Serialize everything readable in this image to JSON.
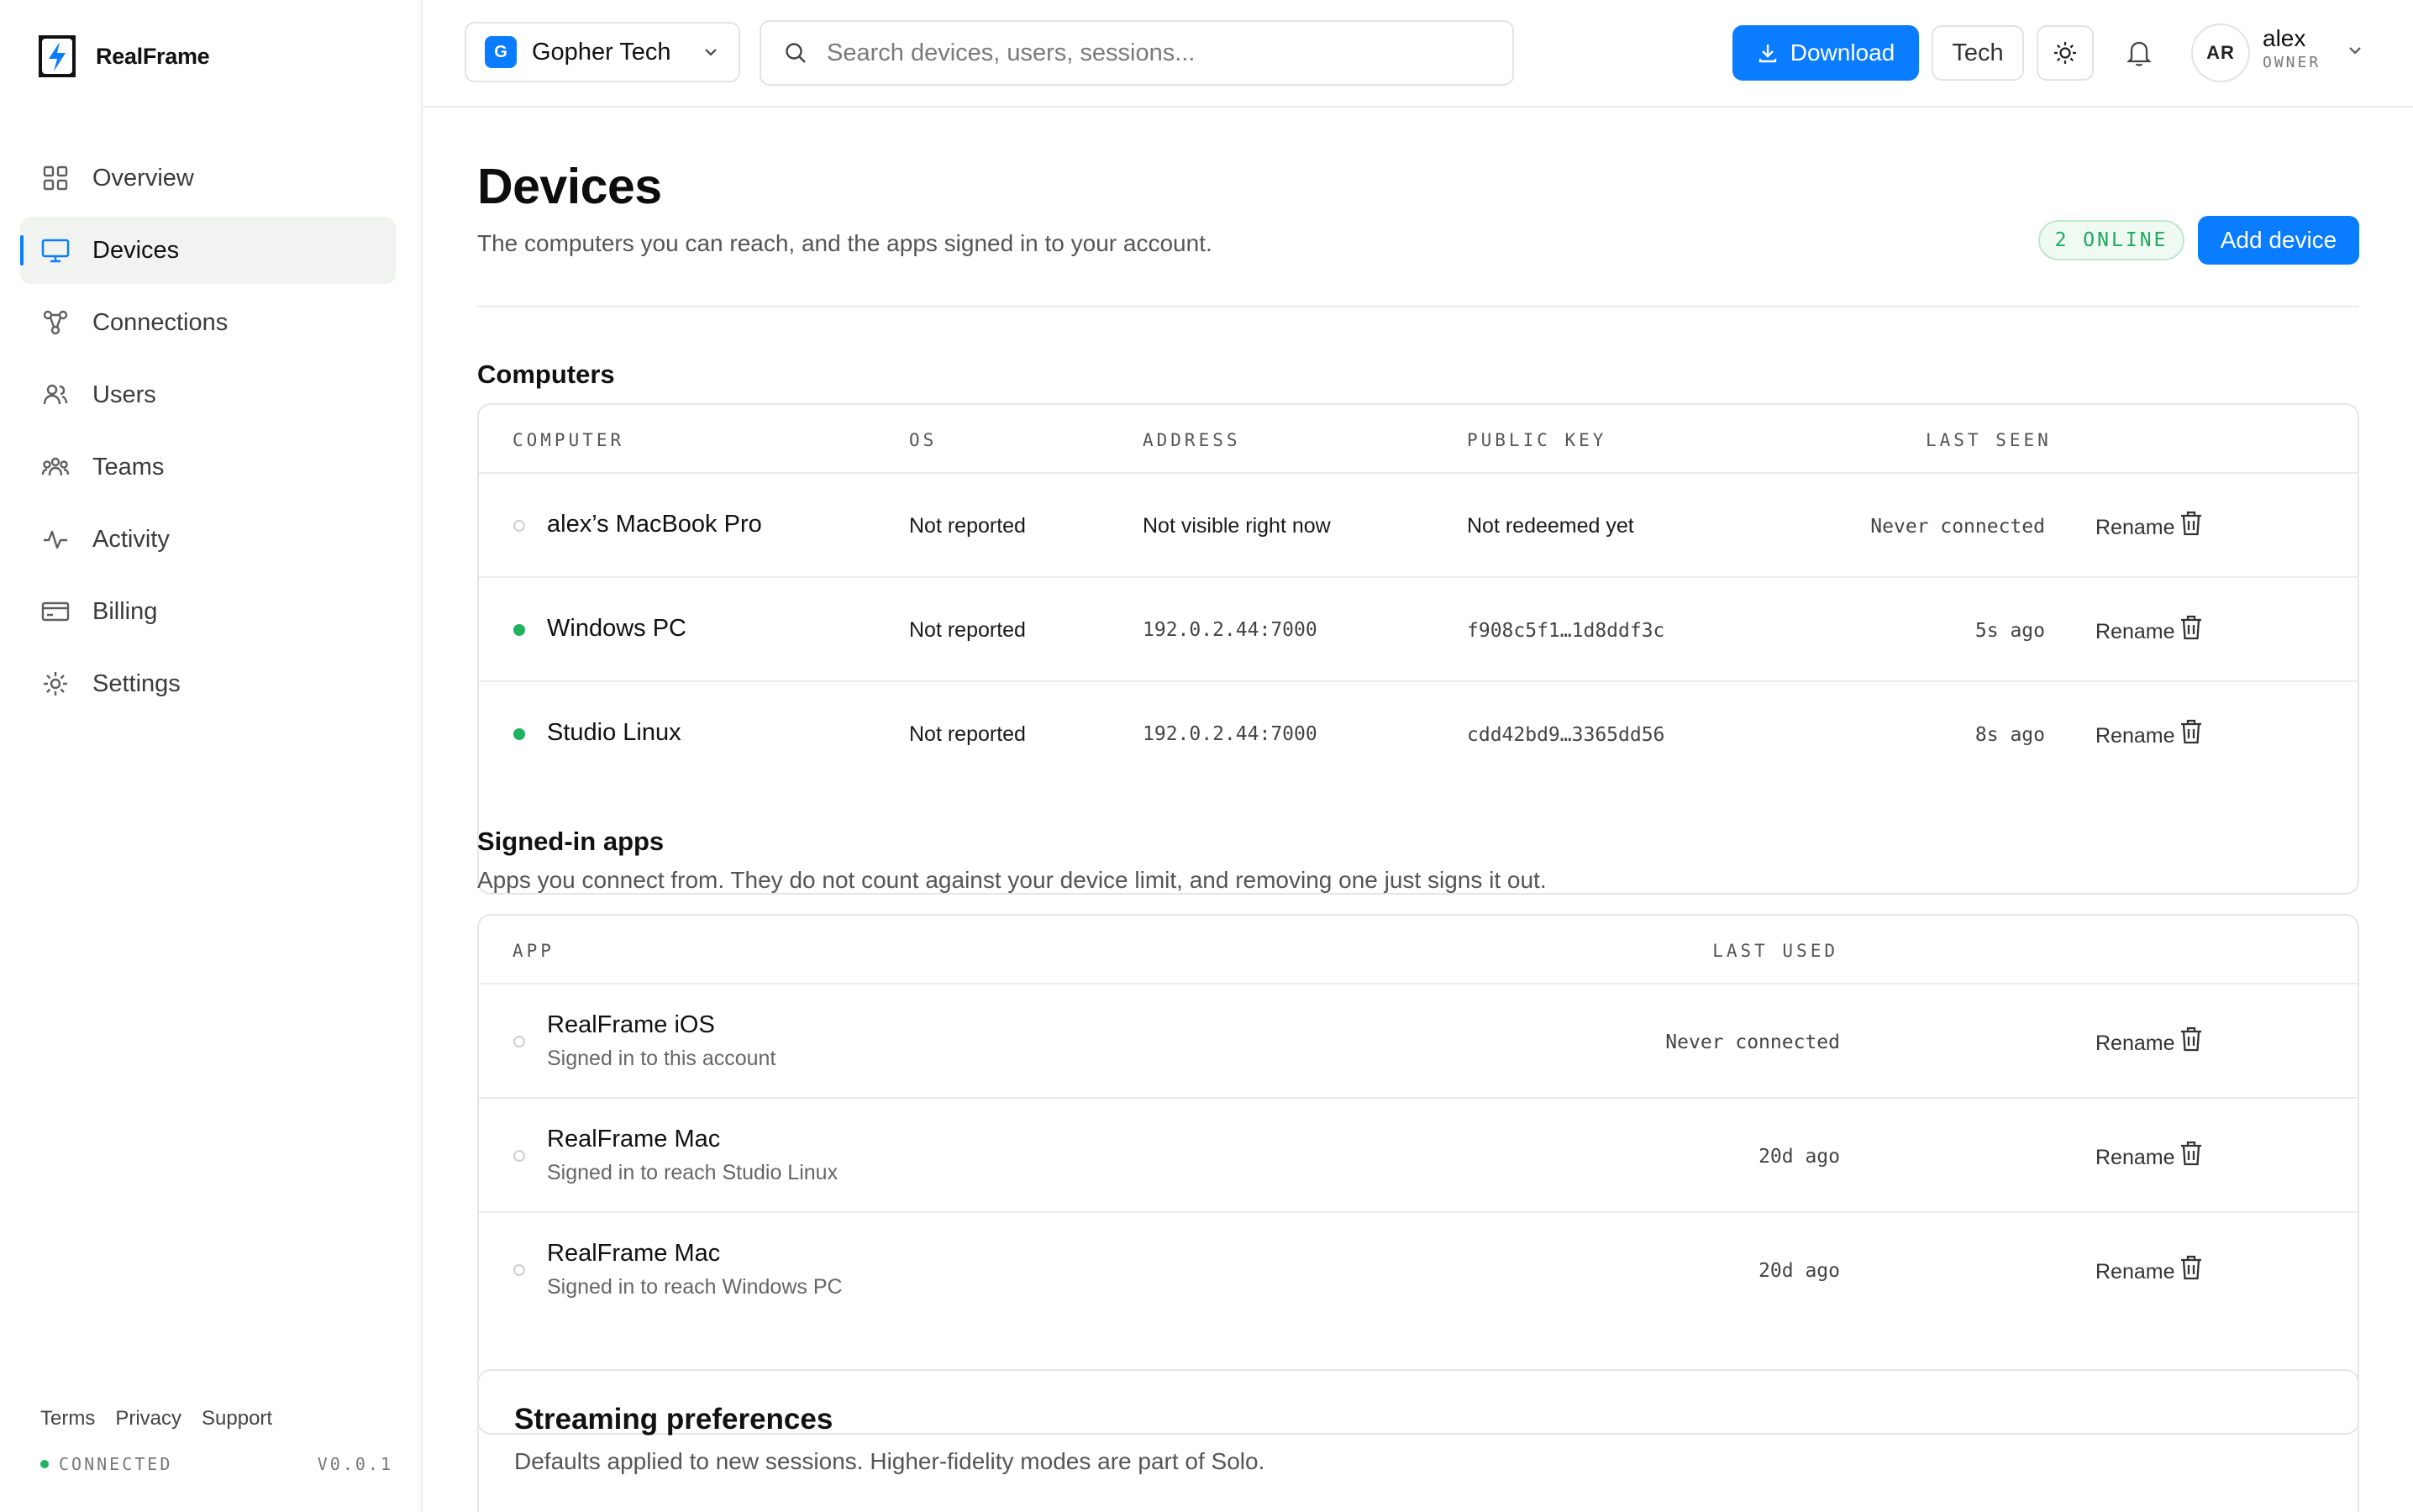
{
  "brand": {
    "name": "RealFrame"
  },
  "sidebar": {
    "items": [
      {
        "label": "Overview",
        "icon": "grid-icon"
      },
      {
        "label": "Devices",
        "icon": "monitor-icon",
        "active": true
      },
      {
        "label": "Connections",
        "icon": "network-icon"
      },
      {
        "label": "Users",
        "icon": "users-icon"
      },
      {
        "label": "Teams",
        "icon": "team-icon"
      },
      {
        "label": "Activity",
        "icon": "activity-icon"
      },
      {
        "label": "Billing",
        "icon": "credit-card-icon"
      },
      {
        "label": "Settings",
        "icon": "gear-icon"
      }
    ],
    "footer": {
      "links": [
        "Terms",
        "Privacy",
        "Support"
      ],
      "status": "CONNECTED",
      "version": "V0.0.1"
    }
  },
  "topbar": {
    "org_badge": "G",
    "org_name": "Gopher Tech",
    "search_placeholder": "Search devices, users, sessions...",
    "download_label": "Download",
    "tech_label": "Tech",
    "avatar_initials": "AR",
    "user_name": "alex",
    "user_role": "OWNER"
  },
  "page": {
    "title": "Devices",
    "subtitle": "The computers you can reach, and the apps signed in to your account.",
    "online_badge": "2 ONLINE",
    "add_device_label": "Add device"
  },
  "computers": {
    "title": "Computers",
    "columns": [
      "COMPUTER",
      "OS",
      "ADDRESS",
      "PUBLIC KEY",
      "LAST SEEN"
    ],
    "rows": [
      {
        "name": "alex’s MacBook Pro",
        "online": false,
        "os": "Not reported",
        "address": "Not visible right now",
        "public_key": "Not redeemed yet",
        "last_seen": "Never connected",
        "rename": "Rename"
      },
      {
        "name": "Windows PC",
        "online": true,
        "os": "Not reported",
        "address": "192.0.2.44:7000",
        "public_key": "f908c5f1…1d8ddf3c",
        "last_seen": "5s ago",
        "rename": "Rename"
      },
      {
        "name": "Studio Linux",
        "online": true,
        "os": "Not reported",
        "address": "192.0.2.44:7000",
        "public_key": "cdd42bd9…3365dd56",
        "last_seen": "8s ago",
        "rename": "Rename"
      }
    ]
  },
  "apps": {
    "title": "Signed-in apps",
    "subtitle": "Apps you connect from. They do not count against your device limit, and removing one just signs it out.",
    "columns": [
      "APP",
      "LAST USED"
    ],
    "rows": [
      {
        "name": "RealFrame iOS",
        "detail": "Signed in to this account",
        "last_used": "Never connected",
        "rename": "Rename"
      },
      {
        "name": "RealFrame Mac",
        "detail": "Signed in to reach Studio Linux",
        "last_used": "20d ago",
        "rename": "Rename"
      },
      {
        "name": "RealFrame Mac",
        "detail": "Signed in to reach Windows PC",
        "last_used": "20d ago",
        "rename": "Rename"
      }
    ]
  },
  "streaming": {
    "title": "Streaming preferences",
    "subtitle": "Defaults applied to new sessions. Higher-fidelity modes are part of Solo."
  },
  "colors": {
    "accent": "#0a7cff",
    "online": "#20b25e",
    "border": "#e6e6e6"
  }
}
